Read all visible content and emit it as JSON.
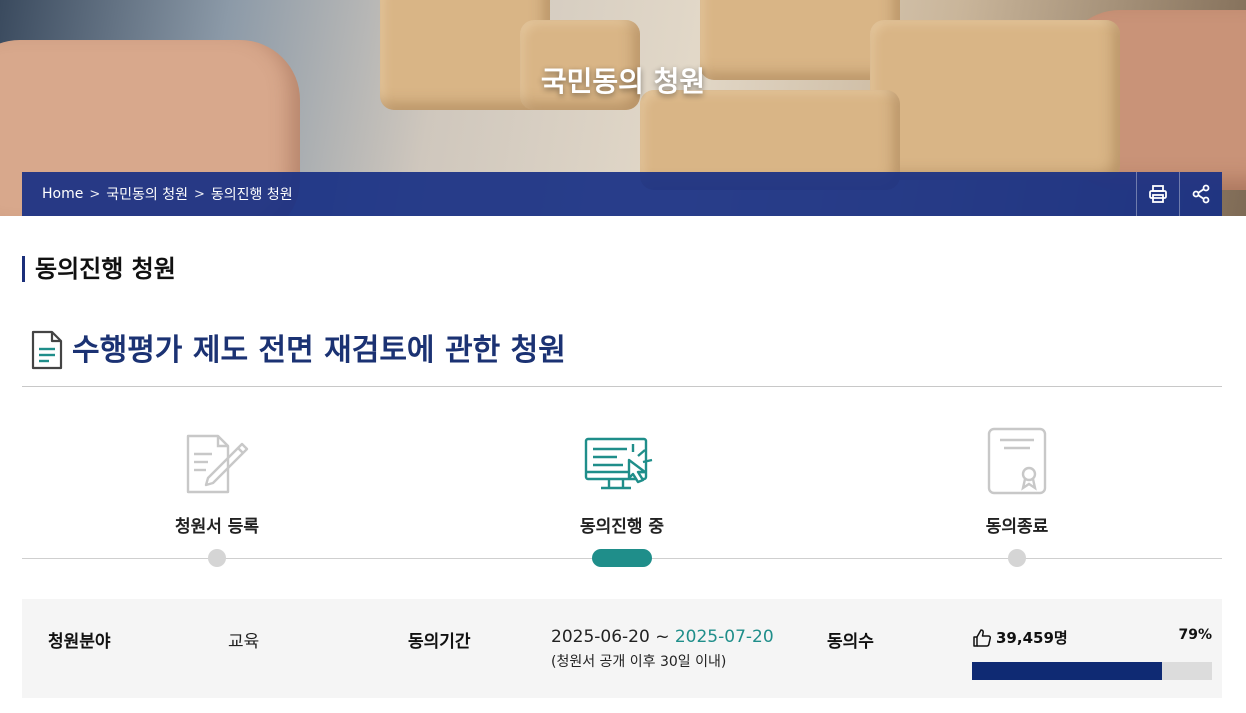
{
  "hero": {
    "title": "국민동의 청원"
  },
  "breadcrumb": {
    "items": [
      "Home",
      "국민동의 청원",
      "동의진행 청원"
    ],
    "separator": ">"
  },
  "toolbar": {
    "print_icon": "printer-icon",
    "share_icon": "share-icon"
  },
  "section": {
    "title": "동의진행 청원"
  },
  "petition": {
    "title": "수행평가 제도 전면 재검토에 관한 청원",
    "icon": "document-icon"
  },
  "steps": [
    {
      "label": "청원서 등록",
      "icon": "form-pen-icon",
      "active": false
    },
    {
      "label": "동의진행 중",
      "icon": "monitor-click-icon",
      "active": true
    },
    {
      "label": "동의종료",
      "icon": "certificate-icon",
      "active": false
    }
  ],
  "info": {
    "field_label": "청원분야",
    "field_value": "교육",
    "period_label": "동의기간",
    "period_start": "2025-06-20",
    "period_sep": " ~ ",
    "period_end": "2025-07-20",
    "period_note": "(청원서 공개 이후 30일 이내)",
    "votes_label": "동의수",
    "votes_count": "39,459명",
    "percent_text": "79%",
    "progress": 0.79
  },
  "colors": {
    "accent": "#1f8e8a",
    "navy": "#1b3273",
    "bar": "#0f2a73"
  }
}
